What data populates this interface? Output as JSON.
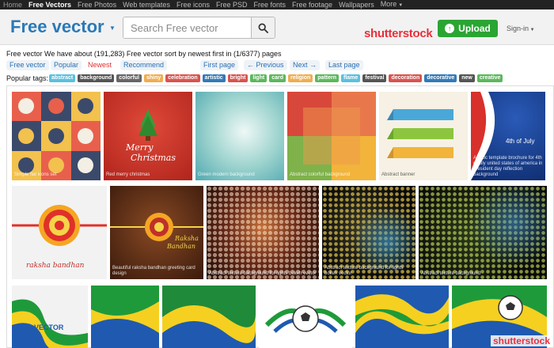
{
  "topnav": {
    "home": "Home",
    "items": [
      "Free Vectors",
      "Free Photos",
      "Web templates",
      "Free icons",
      "Free PSD",
      "Free fonts",
      "Free footage",
      "Wallpapers",
      "More"
    ]
  },
  "header": {
    "brand": "Free vector",
    "search_placeholder": "Search Free vector",
    "partner": "shutterstock",
    "upload_label": "Upload",
    "signin_label": "Sign-in"
  },
  "info": {
    "text": "Free vector We have about (191,283) Free vector sort by newest first in (1/6377) pages"
  },
  "tabs": [
    "Free vector",
    "Popular",
    "Newest",
    "Recommend"
  ],
  "pagination": [
    "First page",
    "← Previous",
    "Next →",
    "Last page"
  ],
  "tags": {
    "label": "Popular tags:",
    "items": [
      {
        "text": "abstract",
        "color": "#5bc0de"
      },
      {
        "text": "background",
        "color": "#555555"
      },
      {
        "text": "colorful",
        "color": "#666666"
      },
      {
        "text": "shiny",
        "color": "#f0ad4e"
      },
      {
        "text": "celebration",
        "color": "#d9534f"
      },
      {
        "text": "artistic",
        "color": "#337ab7"
      },
      {
        "text": "bright",
        "color": "#d9534f"
      },
      {
        "text": "light",
        "color": "#5cb85c"
      },
      {
        "text": "card",
        "color": "#5cb85c"
      },
      {
        "text": "religion",
        "color": "#f0ad4e"
      },
      {
        "text": "pattern",
        "color": "#5cb85c"
      },
      {
        "text": "flame",
        "color": "#5bc0de"
      },
      {
        "text": "festival",
        "color": "#555555"
      },
      {
        "text": "decoration",
        "color": "#d9534f"
      },
      {
        "text": "decorative",
        "color": "#337ab7"
      },
      {
        "text": "new",
        "color": "#555555"
      },
      {
        "text": "creative",
        "color": "#5cb85c"
      }
    ]
  },
  "gallery": {
    "captions": [
      "Simple flat icons set",
      "Red merry christmas",
      "Green modern background",
      "Abstract colorful background",
      "Abstract banner",
      "Artistic template brochure for 4th of july united states of america in president day reflection background",
      "",
      "Beautiful raksha bandhan greeting card design",
      "Abstract texture background for lights bokeh vector",
      "Abstract texture background for lights bokeh vector",
      "Abstract texture background",
      "",
      "",
      "",
      "",
      "",
      ""
    ],
    "merry": "Merry",
    "christmas": "Christmas",
    "july": "4th of July",
    "rakhi": "raksha bandhan",
    "rakhi2": "Raksha",
    "rakhi3": "Bandhan",
    "vector_word": "VECTOR",
    "watermark": "shutterstock"
  }
}
